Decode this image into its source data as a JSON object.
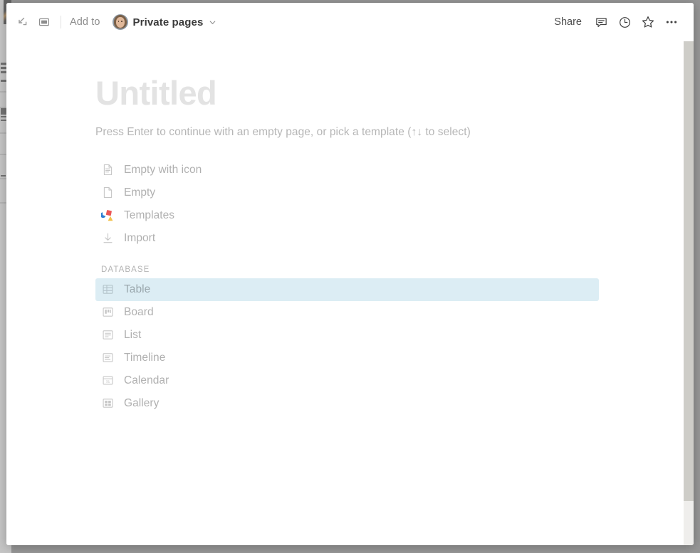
{
  "topbar": {
    "collapse_icon": "collapse-arrows-icon",
    "fullpage_icon": "open-center-peek-icon",
    "add_to_label": "Add to",
    "breadcrumb": {
      "workspace": "Private pages",
      "chevron": "chevron-down-icon",
      "avatar": "user-avatar"
    },
    "share_label": "Share",
    "comment_icon": "comment-bubble-icon",
    "history_icon": "clock-history-icon",
    "favorite_icon": "star-icon",
    "more_icon": "more-options-icon"
  },
  "page": {
    "title_placeholder": "Untitled",
    "hint": "Press Enter to continue with an empty page, or pick a template (↑↓ to select)"
  },
  "options": [
    {
      "label": "Empty with icon",
      "icon": "document-with-icon",
      "selected": false
    },
    {
      "label": "Empty",
      "icon": "blank-document-icon",
      "selected": false
    },
    {
      "label": "Templates",
      "icon": "templates-shapes-icon",
      "selected": false
    },
    {
      "label": "Import",
      "icon": "import-download-icon",
      "selected": false
    }
  ],
  "database_section": {
    "heading": "DATABASE",
    "items": [
      {
        "label": "Table",
        "icon": "table-view-icon",
        "selected": true
      },
      {
        "label": "Board",
        "icon": "board-view-icon",
        "selected": false
      },
      {
        "label": "List",
        "icon": "list-view-icon",
        "selected": false
      },
      {
        "label": "Timeline",
        "icon": "timeline-view-icon",
        "selected": false
      },
      {
        "label": "Calendar",
        "icon": "calendar-view-icon",
        "selected": false
      },
      {
        "label": "Gallery",
        "icon": "gallery-view-icon",
        "selected": false
      }
    ]
  },
  "colors": {
    "selected_row_bg": "#dcedf4",
    "backdrop": "#969696",
    "placeholder_text": "#e3e3e3",
    "muted_text": "#b0b0b0"
  },
  "calendar_icon_day": "31"
}
